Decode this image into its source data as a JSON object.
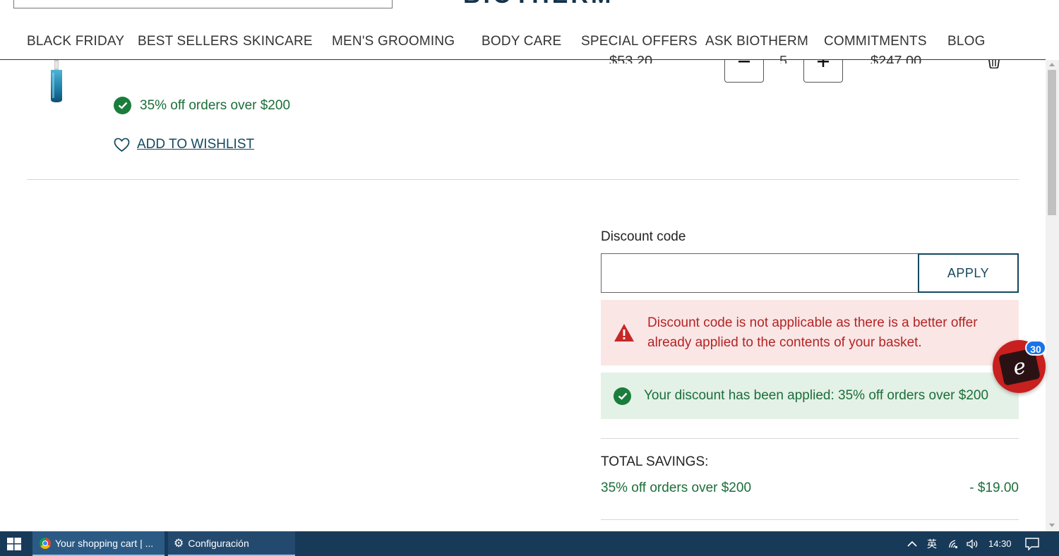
{
  "header": {
    "brand": "BIOTHERM"
  },
  "nav": {
    "items": [
      {
        "label": "BLACK FRIDAY"
      },
      {
        "label": "BEST SELLERS"
      },
      {
        "label": "SKINCARE"
      },
      {
        "label": "MEN'S GROOMING"
      },
      {
        "label": "BODY CARE"
      },
      {
        "label": "SPECIAL OFFERS"
      },
      {
        "label": "ASK BIOTHERM"
      },
      {
        "label": "COMMITMENTS"
      },
      {
        "label": "BLOG"
      }
    ]
  },
  "cart_item": {
    "unit_price": "$53.20",
    "quantity": "5",
    "total": "$247.00",
    "offer": "35% off orders over $200",
    "wishlist_label": "ADD TO WISHLIST"
  },
  "discount": {
    "label": "Discount code",
    "input_value": "",
    "apply_label": "APPLY",
    "error_message": "Discount code is not applicable as there is a better offer already applied to the contents of your basket.",
    "success_message": "Your discount has been applied: 35% off orders over $200"
  },
  "savings": {
    "title": "TOTAL SAVINGS:",
    "name": "35% off orders over $200",
    "amount": "- $19.00"
  },
  "chat": {
    "badge": "30"
  },
  "taskbar": {
    "chrome_task": "Your shopping cart | ...",
    "config_task": "Configuración",
    "ime": "英",
    "time": "14:30"
  },
  "colors": {
    "brand": "#14324a",
    "link": "#14485e",
    "success": "#1b6e39",
    "error": "#b32424",
    "taskbar": "#183a59"
  }
}
